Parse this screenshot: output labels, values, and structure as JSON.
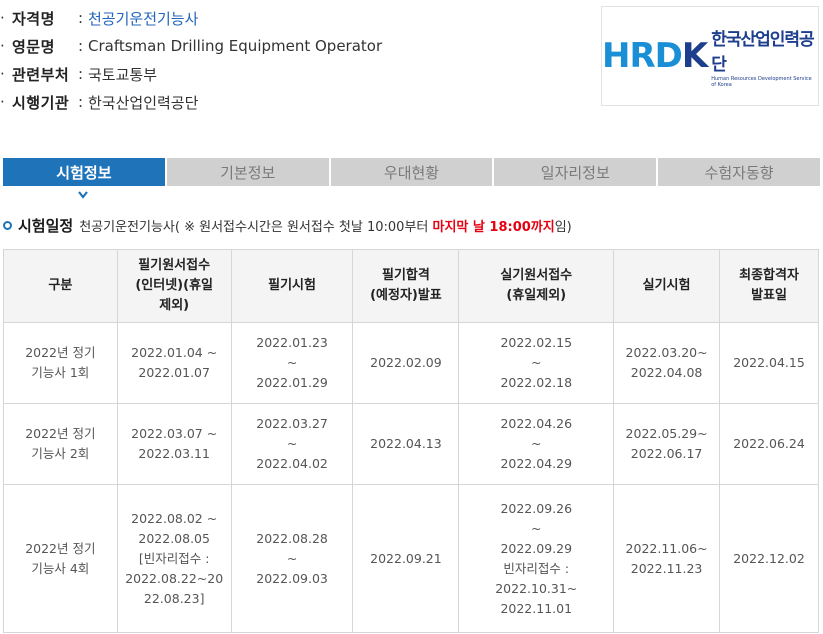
{
  "info": {
    "rows": [
      {
        "label": "자격명",
        "value": "천공기운전기능사"
      },
      {
        "label": "영문명",
        "value": "Craftsman Drilling Equipment Operator"
      },
      {
        "label": "관련부처",
        "value": "국토교통부"
      },
      {
        "label": "시행기관",
        "value": "한국산업인력공단"
      }
    ],
    "bullet": "·",
    "colon": ":"
  },
  "logo": {
    "mark_left": "HRD",
    "mark_right": "K",
    "name_ko": "한국산업인력공단",
    "name_en": "Human Resources Development Service of Korea"
  },
  "tabs": [
    {
      "label": "시험정보",
      "active": true
    },
    {
      "label": "기본정보",
      "active": false
    },
    {
      "label": "우대현황",
      "active": false
    },
    {
      "label": "일자리정보",
      "active": false
    },
    {
      "label": "수험자동향",
      "active": false
    }
  ],
  "section": {
    "title": "시험일정",
    "desc_prefix": "천공기운전기능사( ※ 원서접수시간은 원서접수 첫날 10:00부터 ",
    "desc_red": "마지막 날 18:00까지",
    "desc_suffix": "임)"
  },
  "table": {
    "headers": [
      [
        "구분"
      ],
      [
        "필기원서접수",
        "(인터넷)(휴일",
        "제외)"
      ],
      [
        "필기시험"
      ],
      [
        "필기합격",
        "(예정자)발표"
      ],
      [
        "실기원서접수",
        "(휴일제외)"
      ],
      [
        "실기시험"
      ],
      [
        "최종합격자",
        "발표일"
      ]
    ],
    "rows": [
      [
        [
          "2022년 정기",
          "기능사 1회"
        ],
        [
          "2022.01.04 ~",
          "2022.01.07"
        ],
        [
          "2022.01.23",
          "~",
          "2022.01.29"
        ],
        [
          "2022.02.09"
        ],
        [
          "2022.02.15",
          "~",
          "2022.02.18"
        ],
        [
          "2022.03.20~",
          "2022.04.08"
        ],
        [
          "2022.04.15"
        ]
      ],
      [
        [
          "2022년 정기",
          "기능사 2회"
        ],
        [
          "2022.03.07 ~",
          "2022.03.11"
        ],
        [
          "2022.03.27",
          "~",
          "2022.04.02"
        ],
        [
          "2022.04.13"
        ],
        [
          "2022.04.26",
          "~",
          "2022.04.29"
        ],
        [
          "2022.05.29~",
          "2022.06.17"
        ],
        [
          "2022.06.24"
        ]
      ],
      [
        [
          "2022년 정기",
          "기능사 4회"
        ],
        [
          "2022.08.02 ~",
          "2022.08.05",
          "[빈자리접수 :",
          "2022.08.22~20",
          "22.08.23]"
        ],
        [
          "2022.08.28",
          "~",
          "2022.09.03"
        ],
        [
          "2022.09.21"
        ],
        [
          "2022.09.26",
          "~",
          "2022.09.29",
          "빈자리접수 :",
          "2022.10.31~",
          "2022.11.01"
        ],
        [
          "2022.11.06~",
          "2022.11.23"
        ],
        [
          "2022.12.02"
        ]
      ]
    ]
  },
  "colors": {
    "accent": "#1f74b9",
    "tab_inactive": "#d0d0d0",
    "highlight_red": "#e60012",
    "value_blue": "#2266bb"
  }
}
